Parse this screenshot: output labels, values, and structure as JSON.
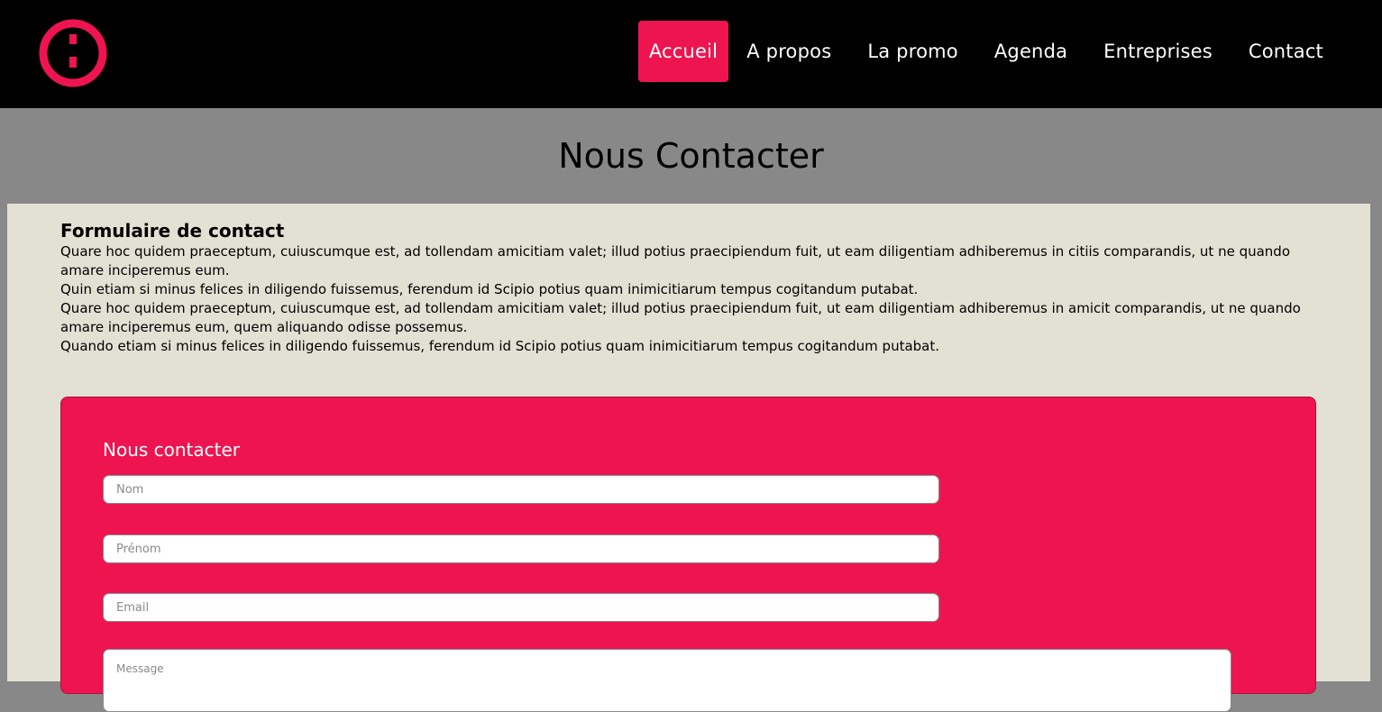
{
  "header": {
    "logo": "round-logo-icon",
    "nav": [
      {
        "label": "Accueil",
        "active": true
      },
      {
        "label": "A propos",
        "active": false
      },
      {
        "label": "La promo",
        "active": false
      },
      {
        "label": "Agenda",
        "active": false
      },
      {
        "label": "Entreprises",
        "active": false
      },
      {
        "label": "Contact",
        "active": false
      }
    ]
  },
  "page_title": "Nous Contacter",
  "intro": {
    "title": "Formulaire de contact",
    "paragraphs": [
      "Quare hoc quidem praeceptum, cuiuscumque est, ad tollendam amicitiam valet; illud potius praecipiendum fuit, ut eam diligentiam adhiberemus in citiis comparandis, ut ne quando amare inciperemus eum.",
      "Quin etiam si minus felices in diligendo fuissemus, ferendum id Scipio potius quam inimicitiarum tempus cogitandum putabat.",
      "Quare hoc quidem praeceptum, cuiuscumque est, ad tollendam amicitiam valet; illud potius praecipiendum fuit, ut eam diligentiam adhiberemus in amicit comparandis, ut ne quando amare inciperemus eum, quem aliquando odisse possemus.",
      "Quando etiam si minus felices in diligendo fuissemus, ferendum id Scipio potius quam inimicitiarum tempus cogitandum putabat."
    ]
  },
  "form": {
    "title": "Nous contacter",
    "nom_placeholder": "Nom",
    "prenom_placeholder": "Prénom",
    "email_placeholder": "Email",
    "message_placeholder": "Message"
  },
  "colors": {
    "accent": "#ee1450",
    "header_bg": "#000000",
    "band_bg": "#888888",
    "panel_bg": "#e3e1d4"
  }
}
